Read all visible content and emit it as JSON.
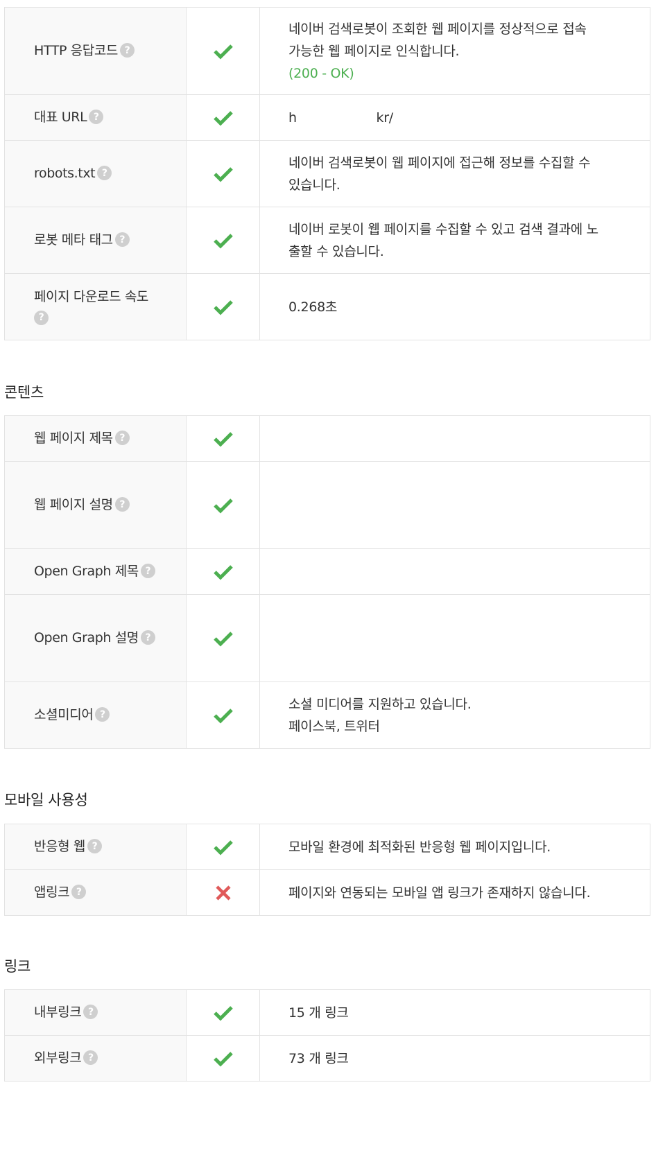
{
  "help_glyph": "?",
  "colors": {
    "check": "#4caf50",
    "cross": "#e05a5a",
    "ok_text": "#4caf50"
  },
  "crawl": {
    "rows": [
      {
        "label": "HTTP 응답코드",
        "status": "ok",
        "lines": [
          "네이버 검색로봇이 조회한 웹 페이지를 정상적으로 접속",
          "가능한 웹 페이지로 인식합니다."
        ],
        "note": "(200 - OK)"
      },
      {
        "label": "대표 URL",
        "status": "ok",
        "lines": [
          "h                    kr/"
        ]
      },
      {
        "label": "robots.txt",
        "status": "ok",
        "lines": [
          "네이버 검색로봇이 웹 페이지에 접근해 정보를 수집할 수",
          "있습니다."
        ]
      },
      {
        "label": "로봇 메타 태그",
        "status": "ok",
        "lines": [
          "네이버 로봇이 웹 페이지를 수집할 수 있고 검색 결과에 노",
          "출할 수 있습니다."
        ]
      },
      {
        "label": "페이지 다운로드 속도",
        "status": "ok",
        "lines": [
          "0.268초"
        ]
      }
    ]
  },
  "content": {
    "title": "콘텐츠",
    "rows": [
      {
        "label": "웹 페이지 제목",
        "status": "ok",
        "lines": [
          ""
        ]
      },
      {
        "label": "웹 페이지 설명",
        "status": "ok",
        "lines": [
          "",
          "",
          ""
        ]
      },
      {
        "label": "Open Graph 제목",
        "status": "ok",
        "lines": [
          ""
        ]
      },
      {
        "label": "Open Graph 설명",
        "status": "ok",
        "lines": [
          "",
          "",
          ""
        ]
      },
      {
        "label": "소셜미디어",
        "status": "ok",
        "lines": [
          "소셜 미디어를 지원하고 있습니다.",
          "페이스북, 트위터"
        ]
      }
    ]
  },
  "mobile": {
    "title": "모바일 사용성",
    "rows": [
      {
        "label": "반응형 웹",
        "status": "ok",
        "lines": [
          "모바일 환경에 최적화된 반응형 웹 페이지입니다."
        ]
      },
      {
        "label": "앱링크",
        "status": "fail",
        "lines": [
          "페이지와 연동되는 모바일 앱 링크가 존재하지 않습니다."
        ]
      }
    ]
  },
  "links": {
    "title": "링크",
    "rows": [
      {
        "label": "내부링크",
        "status": "ok",
        "lines": [
          "15 개 링크"
        ]
      },
      {
        "label": "외부링크",
        "status": "ok",
        "lines": [
          "73 개 링크"
        ]
      }
    ]
  }
}
